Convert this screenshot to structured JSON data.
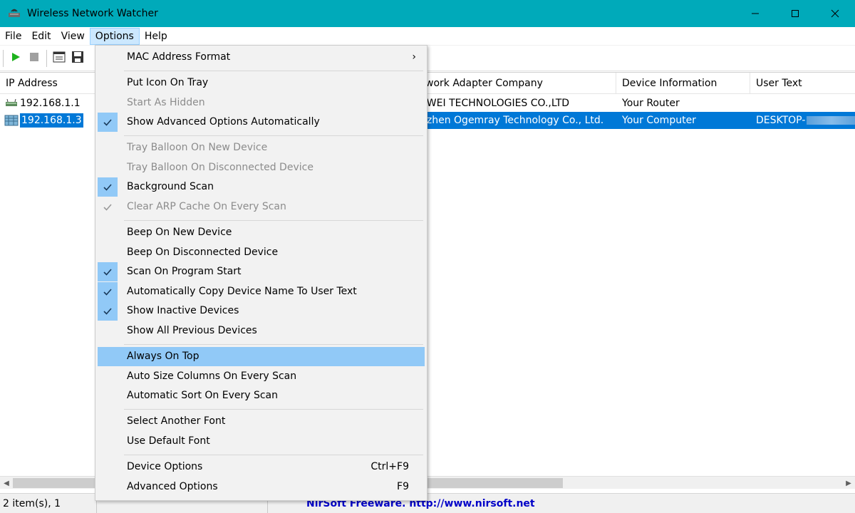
{
  "window": {
    "title": "Wireless Network Watcher",
    "accent": "#00aaba"
  },
  "menubar": {
    "items": [
      "File",
      "Edit",
      "View",
      "Options",
      "Help"
    ],
    "active": "Options"
  },
  "listview": {
    "columns": [
      "IP Address",
      "",
      "Network Adapter Company",
      "Device Information",
      "User Text"
    ],
    "column_visible_text": [
      "IP Address",
      "work Adapter Company",
      "Device Information",
      "User Text"
    ],
    "rows": [
      {
        "ip": "192.168.1.1",
        "company": "AWEI TECHNOLOGIES CO.,LTD",
        "device_info": "Your Router",
        "user_text": ""
      },
      {
        "ip": "192.168.1.3",
        "company": "nzhen Ogemray Technology Co., Ltd.",
        "device_info": "Your Computer",
        "user_text": "DESKTOP-",
        "selected": true
      }
    ]
  },
  "statusbar": {
    "count": "2 item(s), 1 Selected",
    "link": "NirSoft Freeware.  http://www.nirsoft.net"
  },
  "options_menu": {
    "mac_format": "MAC Address Format",
    "put_icon": "Put Icon On Tray",
    "start_hidden": "Start As Hidden",
    "show_advanced": "Show Advanced Options Automatically",
    "tray_new": "Tray Balloon On New Device",
    "tray_disconnected": "Tray Balloon On Disconnected Device",
    "background_scan": "Background Scan",
    "clear_arp": "Clear ARP Cache On Every Scan",
    "beep_new": "Beep On New Device",
    "beep_disconnected": "Beep On Disconnected Device",
    "scan_on_start": "Scan On Program Start",
    "auto_copy": "Automatically Copy Device Name To User Text",
    "show_inactive": "Show Inactive Devices",
    "show_all_previous": "Show All Previous Devices",
    "always_on_top": "Always On Top",
    "auto_size": "Auto Size Columns On Every Scan",
    "auto_sort": "Automatic Sort On Every Scan",
    "select_font": "Select Another Font",
    "default_font": "Use Default Font",
    "device_options": "Device Options",
    "device_options_shortcut": "Ctrl+F9",
    "advanced_options": "Advanced Options",
    "advanced_options_shortcut": "F9",
    "highlight_color": "#91c9f7"
  }
}
